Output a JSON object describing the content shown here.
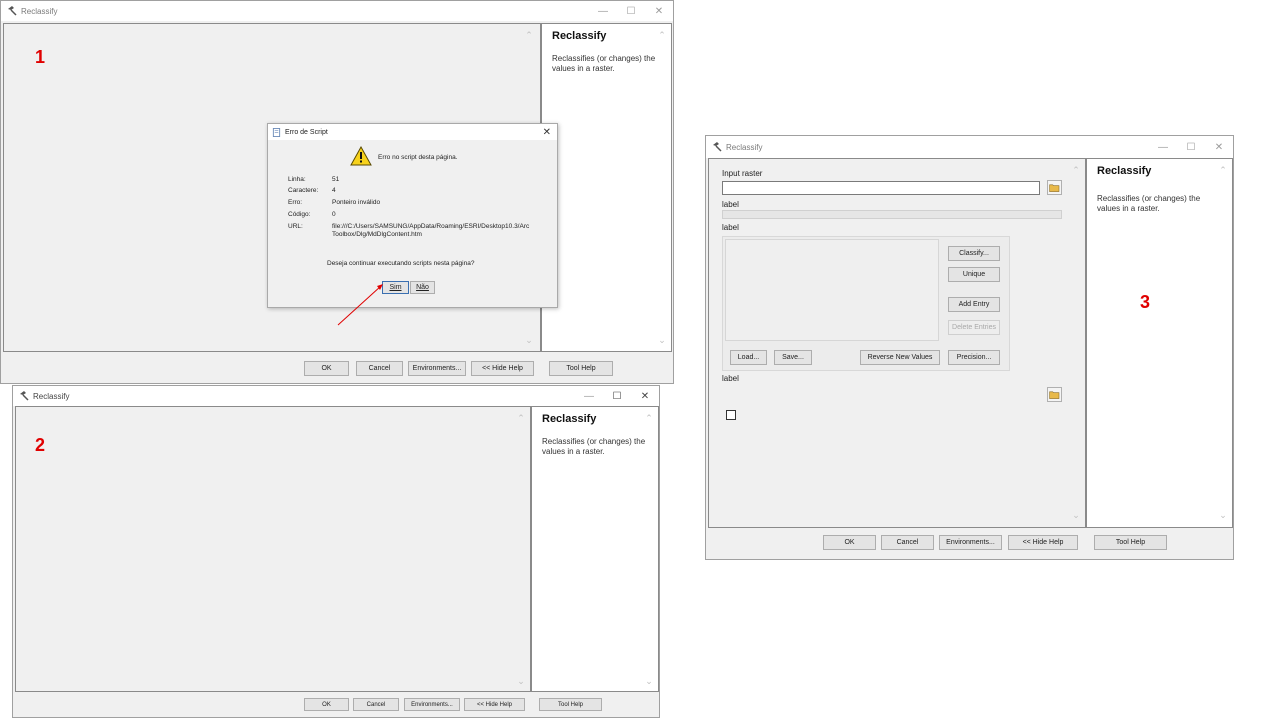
{
  "labels": {
    "one": "1",
    "two": "2",
    "three": "3"
  },
  "window1": {
    "title": "Reclassify",
    "help_title": "Reclassify",
    "help_desc": "Reclassifies (or changes) the values in a raster.",
    "buttons": {
      "ok": "OK",
      "cancel": "Cancel",
      "environments": "Environments...",
      "hide_help": "<< Hide Help",
      "tool_help": "Tool Help"
    }
  },
  "error_dialog": {
    "title": "Erro de Script",
    "message": "Erro no script desta página.",
    "fields": [
      {
        "key": "Linha:",
        "value": "51"
      },
      {
        "key": "Caractere:",
        "value": "4"
      },
      {
        "key": "Erro:",
        "value": "Ponteiro inválido"
      },
      {
        "key": "Código:",
        "value": "0"
      },
      {
        "key": "URL:",
        "value": "file:///C:/Users/SAMSUNG/AppData/Roaming/ESRI/Desktop10.3/ArcToolbox/Dlg/MdDlgContent.htm"
      }
    ],
    "question": "Deseja continuar executando scripts nesta página?",
    "yes": "Sim",
    "no": "Não"
  },
  "window2": {
    "title": "Reclassify",
    "help_title": "Reclassify",
    "help_desc": "Reclassifies (or changes) the values in a raster.",
    "buttons": {
      "ok": "OK",
      "cancel": "Cancel",
      "environments": "Environments...",
      "hide_help": "<< Hide Help",
      "tool_help": "Tool Help"
    }
  },
  "window3": {
    "title": "Reclassify",
    "input_raster_label": "Input raster",
    "label1": "label",
    "label2": "label",
    "label3": "label",
    "grid_buttons": {
      "classify": "Classify...",
      "unique": "Unique",
      "add_entry": "Add Entry",
      "delete_entries": "Delete Entries"
    },
    "grid_bottom": {
      "load": "Load...",
      "save": "Save...",
      "reverse": "Reverse New Values",
      "precision": "Precision..."
    },
    "help_title": "Reclassify",
    "help_desc": "Reclassifies (or changes) the values in a raster.",
    "buttons": {
      "ok": "OK",
      "cancel": "Cancel",
      "environments": "Environments...",
      "hide_help": "<< Hide Help",
      "tool_help": "Tool Help"
    }
  },
  "icons": {
    "tool": "hammer-icon",
    "warning": "warning-icon",
    "folder": "folder-open-icon",
    "page": "page-icon"
  },
  "colors": {
    "annotation": "#e00000",
    "arrow": "#e00000"
  }
}
